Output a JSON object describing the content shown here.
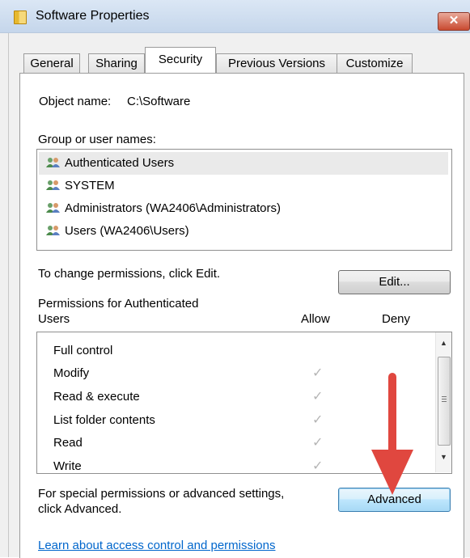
{
  "window": {
    "title": "Software Properties",
    "close_glyph": "✕"
  },
  "tabs": [
    {
      "label": "General"
    },
    {
      "label": "Sharing"
    },
    {
      "label": "Security"
    },
    {
      "label": "Previous Versions"
    },
    {
      "label": "Customize"
    }
  ],
  "security": {
    "object_name_label": "Object name:",
    "object_name_value": "C:\\Software",
    "group_label": "Group or user names:",
    "users": [
      {
        "name": "Authenticated Users",
        "icon": "users-icon",
        "selected": true
      },
      {
        "name": "SYSTEM",
        "icon": "users-icon",
        "selected": false
      },
      {
        "name": "Administrators (WA2406\\Administrators)",
        "icon": "users-icon",
        "selected": false
      },
      {
        "name": "Users (WA2406\\Users)",
        "icon": "users-icon",
        "selected": false
      }
    ],
    "change_permissions_text": "To change permissions, click Edit.",
    "edit_button": "Edit...",
    "permissions_for_line1": "Permissions for Authenticated",
    "permissions_for_line2": "Users",
    "col_allow": "Allow",
    "col_deny": "Deny",
    "permissions": [
      {
        "name": "Full control",
        "allow": false
      },
      {
        "name": "Modify",
        "allow": true
      },
      {
        "name": "Read & execute",
        "allow": true
      },
      {
        "name": "List folder contents",
        "allow": true
      },
      {
        "name": "Read",
        "allow": true
      },
      {
        "name": "Write",
        "allow": true
      }
    ],
    "check_glyph": "✓",
    "special_text_line1": "For special permissions or advanced settings,",
    "special_text_line2": "click Advanced.",
    "advanced_button": "Advanced",
    "learn_link": "Learn about access control and permissions"
  },
  "colors": {
    "annotation_arrow": "#e0473f",
    "link": "#0066cc"
  }
}
